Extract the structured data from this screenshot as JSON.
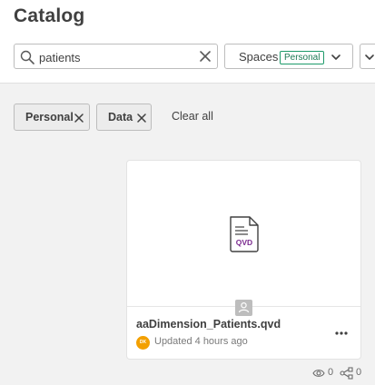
{
  "page": {
    "title": "Catalog"
  },
  "search": {
    "value": "patients"
  },
  "filters": {
    "spaces_label": "Spaces",
    "spaces_selected": "Personal"
  },
  "chips": [
    {
      "label": "Personal"
    },
    {
      "label": "Data"
    }
  ],
  "clear_all_label": "Clear all",
  "card": {
    "name": "aaDimension_Patients.qvd",
    "file_type": "QVD",
    "owner_initials": "DK",
    "updated": "Updated 4 hours ago",
    "views": "0",
    "lineage": "0"
  },
  "colors": {
    "accent_green": "#1d9a6a",
    "qvd_purple": "#7b2a8f",
    "owner_badge": "#f3a000"
  },
  "icons": [
    "search-icon",
    "clear-icon",
    "chevron-down-icon",
    "close-icon",
    "qvd-file-icon",
    "user-icon",
    "more-icon",
    "eye-icon",
    "lineage-icon"
  ]
}
